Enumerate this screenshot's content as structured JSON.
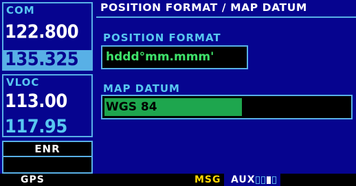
{
  "com": {
    "label": "COM",
    "active_freq": "122.800",
    "standby_freq": "135.325"
  },
  "vloc": {
    "label": "VLOC",
    "active_freq": "113.00",
    "standby_freq": "117.95"
  },
  "cdi": {
    "mode_label": "ENR"
  },
  "page": {
    "title": "POSITION FORMAT / MAP DATUM"
  },
  "position_format": {
    "label": "POSITION FORMAT",
    "value": "hddd°mm.mmm'"
  },
  "map_datum": {
    "label": "MAP DATUM",
    "value": "WGS 84"
  },
  "status_bar": {
    "mode": "GPS",
    "msg": "MSG",
    "page_group": "AUX",
    "page_count": 4,
    "current_page": 3
  },
  "colors": {
    "background": "#06048f",
    "accent": "#58b0e6",
    "label_cyan": "#58c7f0",
    "active_field_green": "#3fe26a",
    "cursor_green": "#1ea64e",
    "msg_yellow": "#ffd800"
  }
}
